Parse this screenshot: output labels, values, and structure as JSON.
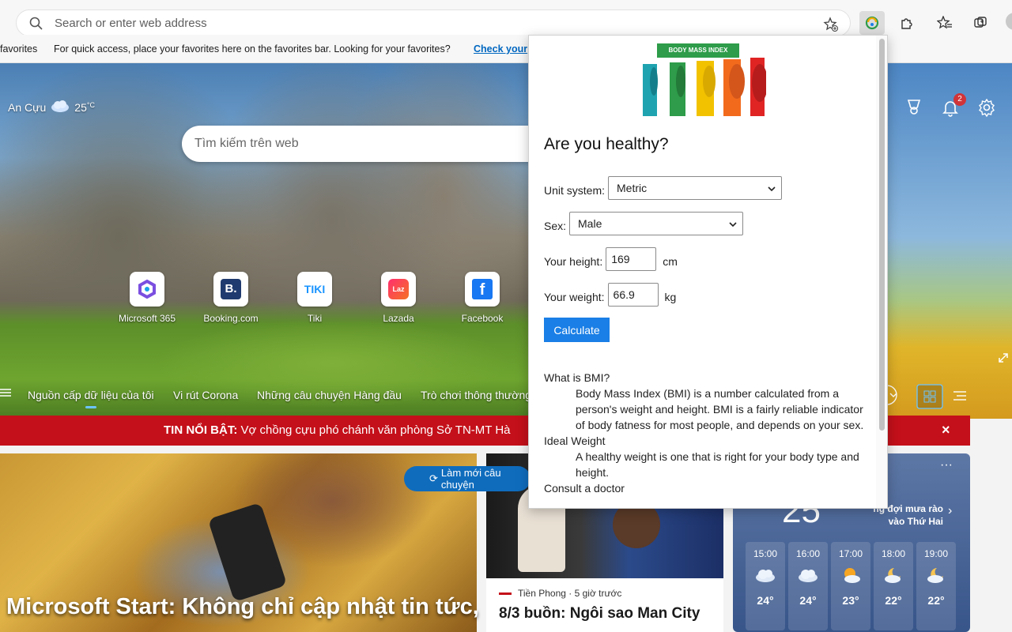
{
  "browser": {
    "address_placeholder": "Search or enter web address",
    "favbar": {
      "left_label": "favorites",
      "message": "For quick access, place your favorites here on the favorites bar. Looking for your favorites?",
      "link": "Check your"
    }
  },
  "ntp": {
    "weather": {
      "location": "An Cựu",
      "temp": "25",
      "unit": "°C"
    },
    "search_placeholder": "Tìm kiếm trên web",
    "notifications_count": "2",
    "quick_links": [
      {
        "label": "Microsoft 365",
        "icon": "microsoft365-icon"
      },
      {
        "label": "Booking.com",
        "icon": "booking-icon"
      },
      {
        "label": "Tiki",
        "icon": "tiki-icon"
      },
      {
        "label": "Lazada",
        "icon": "lazada-icon"
      },
      {
        "label": "Facebook",
        "icon": "facebook-icon"
      }
    ],
    "nav_tabs": [
      "Nguồn cấp dữ liệu của tôi",
      "Vi rút Corona",
      "Những câu chuyện Hàng đầu",
      "Trò chơi thông thường"
    ],
    "breaking": {
      "label": "TIN NỔI BẬT:",
      "text": "Vợ chồng cựu phó chánh văn phòng Sở TN-MT Hà"
    },
    "refresh_label": "Làm mới câu chuyện",
    "main_headline": "Microsoft Start: Không chỉ cập nhật tin tức,",
    "news_card": {
      "source": "Tiền Phong · 5 giờ trước",
      "title": "8/3 buồn: Ngôi sao Man City"
    },
    "weather_card": {
      "temp": "25",
      "condition": "ng đợi mưa rào vào Thứ Hai",
      "hourly": [
        {
          "time": "15:00",
          "temp": "24°",
          "icon": "cloud-icon"
        },
        {
          "time": "16:00",
          "temp": "24°",
          "icon": "cloud-icon"
        },
        {
          "time": "17:00",
          "temp": "23°",
          "icon": "partly-sunny-icon"
        },
        {
          "time": "18:00",
          "temp": "22°",
          "icon": "partly-cloudy-night-icon"
        },
        {
          "time": "19:00",
          "temp": "22°",
          "icon": "partly-cloudy-night-icon"
        }
      ]
    }
  },
  "popup": {
    "logo_banner": "BODY MASS INDEX",
    "heading": "Are you healthy?",
    "unit_label": "Unit system:",
    "unit_value": "Metric",
    "sex_label": "Sex:",
    "sex_value": "Male",
    "height_label": "Your height:",
    "height_value": "169",
    "height_unit": "cm",
    "weight_label": "Your weight:",
    "weight_value": "66.9",
    "weight_unit": "kg",
    "calculate": "Calculate",
    "what_title": "What is BMI?",
    "what_text": "Body Mass Index (BMI) is a number calculated from a person's weight and height. BMI is a fairly reliable indicator of body fatness for most people, and depends on your sex.",
    "ideal_title": "Ideal Weight",
    "ideal_text": "A healthy weight is one that is right for your body type and height.",
    "consult_title": "Consult a doctor"
  },
  "colors": {
    "accent": "#1a7fe6",
    "breaking": "#c4101a",
    "link": "#0067c0"
  }
}
